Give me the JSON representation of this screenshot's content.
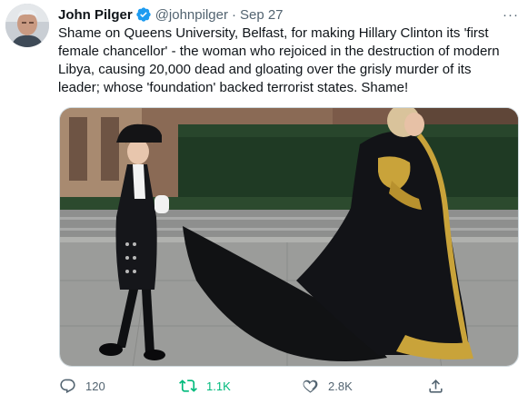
{
  "author": {
    "display_name": "John Pilger",
    "handle": "@johnpilger",
    "separator": "·",
    "timestamp": "Sep 27",
    "verified": true
  },
  "more_menu": "···",
  "tweet_text": {
    "lines": [
      "Shame on Queens University, Belfast, for making Hillary Clinton its 'first",
      "female chancellor' - the woman who rejoiced in the destruction of modern",
      "Libya, causing 20,000 dead and gloating over the grisly murder of its",
      "leader; whose 'foundation' backed terrorist states. Shame!"
    ]
  },
  "actions": {
    "reply_count": "120",
    "retweet_count": "1.1K",
    "like_count": "2.8K",
    "reply_icon": "reply-icon",
    "retweet_icon": "retweet-icon",
    "like_icon": "heart-icon",
    "share_icon": "share-icon"
  },
  "colors": {
    "verified_blue": "#1d9bf0",
    "retweeted_green": "#00ba7c",
    "secondary_text": "#536471"
  }
}
